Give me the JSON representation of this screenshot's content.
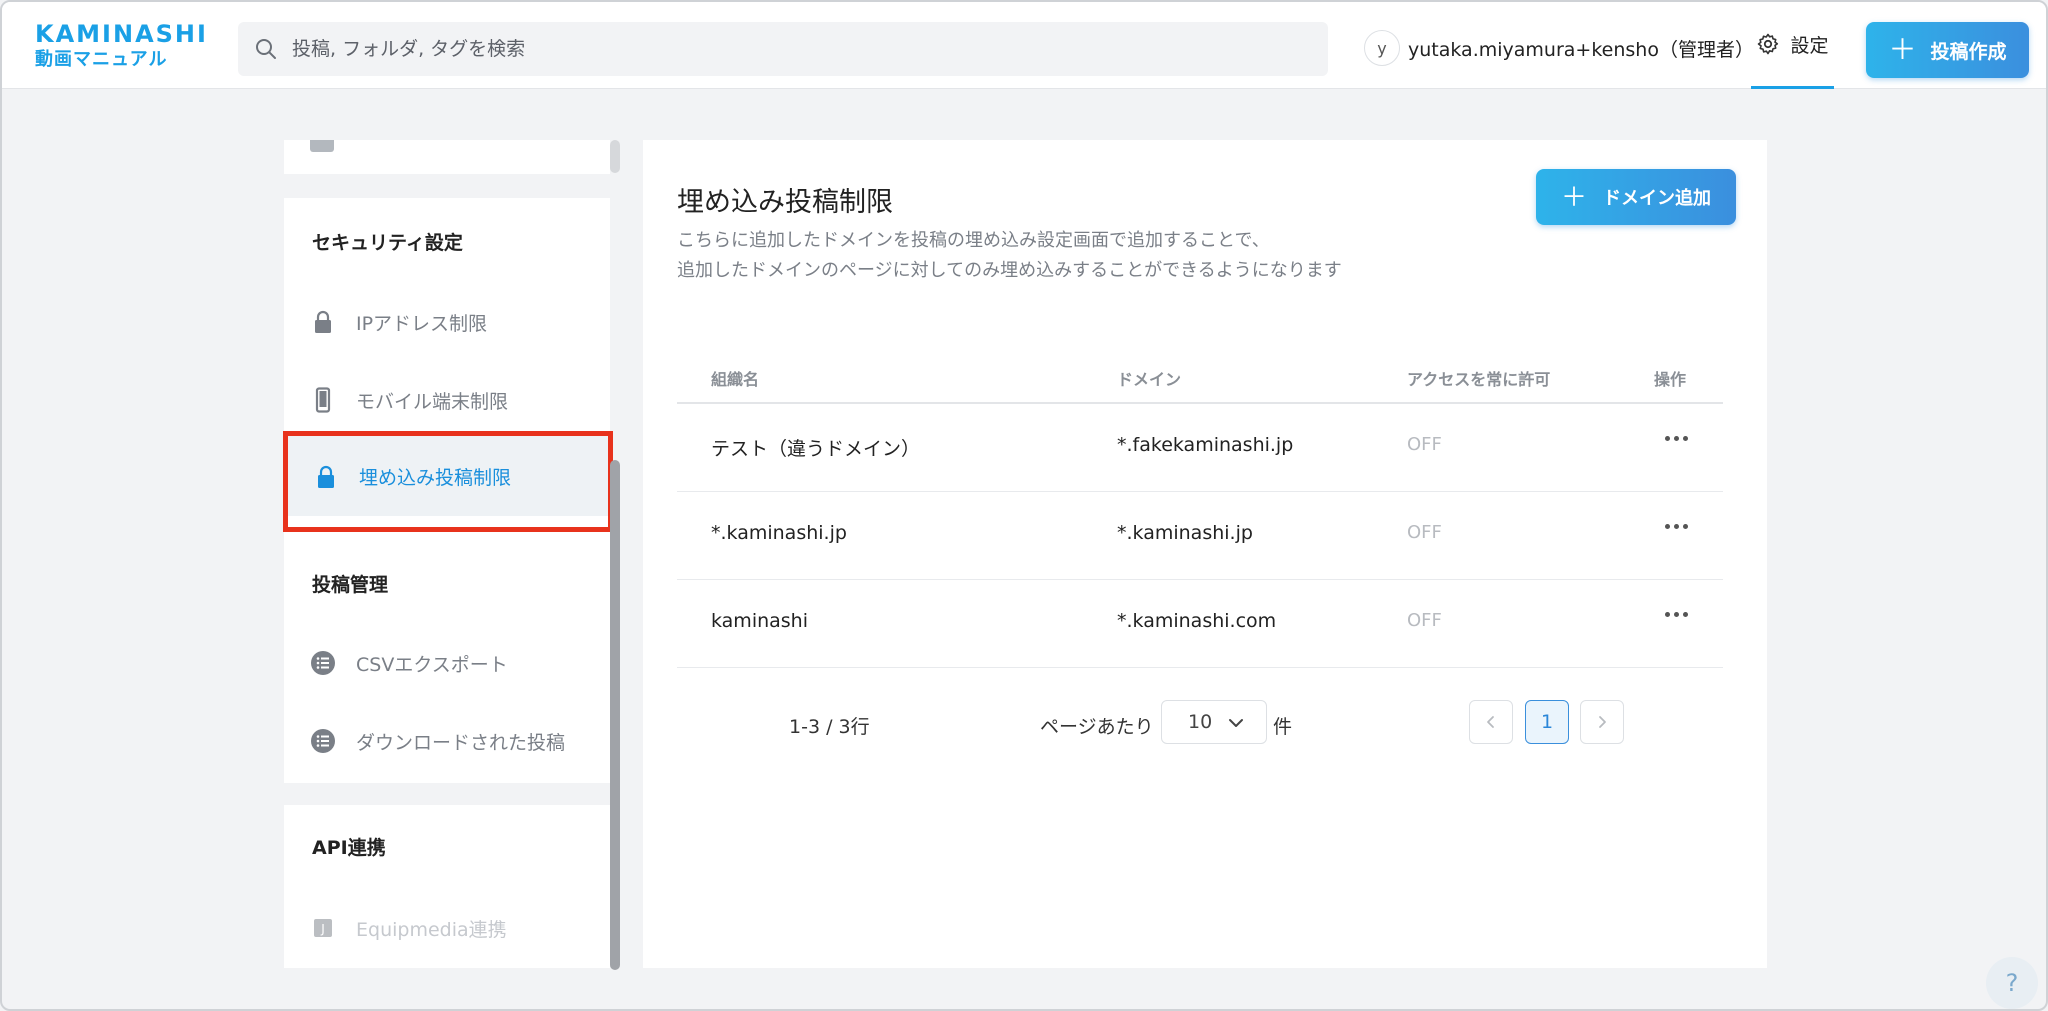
{
  "header": {
    "logo_top": "KAMINASHI",
    "logo_bottom": "動画マニュアル",
    "search_placeholder": "投稿, フォルダ, タグを検索",
    "avatar_initial": "y",
    "user_name": "yutaka.miyamura+kensho（管理者）",
    "settings_label": "設定",
    "create_label": "投稿作成"
  },
  "sidebar": {
    "security_heading": "セキュリティ設定",
    "security_items": [
      {
        "label": "IPアドレス制限",
        "icon": "lock-icon"
      },
      {
        "label": "モバイル端末制限",
        "icon": "mobile-icon"
      },
      {
        "label": "埋め込み投稿制限",
        "icon": "lock-icon",
        "active": true
      }
    ],
    "post_heading": "投稿管理",
    "post_items": [
      {
        "label": "CSVエクスポート",
        "icon": "list-icon"
      },
      {
        "label": "ダウンロードされた投稿",
        "icon": "list-icon"
      }
    ],
    "api_heading": "API連携",
    "api_items": [
      {
        "label": "Equipmedia連携",
        "icon": "equipmedia-icon",
        "disabled": true
      }
    ]
  },
  "main": {
    "title": "埋め込み投稿制限",
    "description_line1": "こちらに追加したドメインを投稿の埋め込み設定画面で追加することで、",
    "description_line2": "追加したドメインのページに対してのみ埋め込みすることができるようになります",
    "add_domain_label": "ドメイン追加",
    "table": {
      "headers": [
        "組織名",
        "ドメイン",
        "アクセスを常に許可",
        "操作"
      ],
      "rows": [
        {
          "org": "テスト（違うドメイン）",
          "domain": "*.fakekaminashi.jp",
          "always_allow": "OFF"
        },
        {
          "org": "*.kaminashi.jp",
          "domain": "*.kaminashi.jp",
          "always_allow": "OFF"
        },
        {
          "org": "kaminashi",
          "domain": "*.kaminashi.com",
          "always_allow": "OFF"
        }
      ]
    },
    "pagination": {
      "range": "1-3 / 3行",
      "per_page_label": "ページあたり",
      "per_page_value": "10",
      "per_page_unit": "件",
      "current_page": "1"
    }
  },
  "help_label": "?",
  "colors": {
    "brand": "#1aa0e6",
    "highlight": "#e8321c",
    "active_text": "#1a8fdc"
  }
}
